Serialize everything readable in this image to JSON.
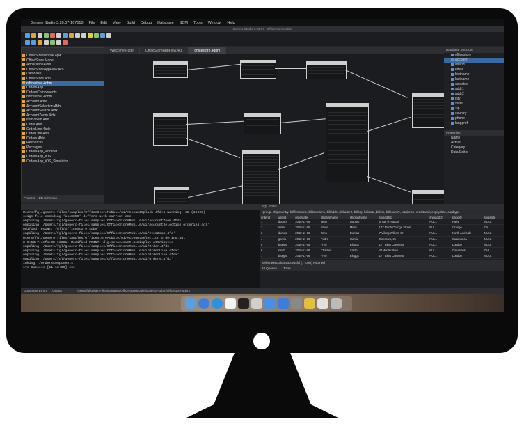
{
  "app": {
    "menubar": {
      "app_name": "Genero Studio 3.20.07-167010",
      "items": [
        "File",
        "Edit",
        "View",
        "Build",
        "Debug",
        "Database",
        "SCM",
        "Tools",
        "Window",
        "Help"
      ]
    },
    "window_title": "Genero Studio 3.20.07 - OfficeStoreMobile"
  },
  "project_tree": {
    "items": [
      {
        "label": "OfficeStoreMobile.4pw",
        "selected": false
      },
      {
        "label": "OfficeStore Model",
        "selected": false
      },
      {
        "label": "ApplicationFlow",
        "selected": false
      },
      {
        "label": "OfficeStoreAppFlow.4ca",
        "selected": false
      },
      {
        "label": "Database",
        "selected": false
      },
      {
        "label": "OfficeStore.4db",
        "selected": false
      },
      {
        "label": "officestore.4dbm",
        "selected": true
      },
      {
        "label": "OrdersApp",
        "selected": false
      },
      {
        "label": "OrdersComponents",
        "selected": false
      },
      {
        "label": "officestore.4dbm",
        "selected": false
      },
      {
        "label": "Account.4dbx",
        "selected": false
      },
      {
        "label": "AccountSelection.4fdx",
        "selected": false
      },
      {
        "label": "AccountSearch.4fdx",
        "selected": false
      },
      {
        "label": "AccountZoom.4fdx",
        "selected": false
      },
      {
        "label": "ItemZoom.4fdx",
        "selected": false
      },
      {
        "label": "Order.4fdx",
        "selected": false
      },
      {
        "label": "OrderLine.4bdx",
        "selected": false
      },
      {
        "label": "OrderLine.4fdx",
        "selected": false
      },
      {
        "label": "Orders.4fdx",
        "selected": false
      },
      {
        "label": "Resources",
        "selected": false
      },
      {
        "label": "Packages",
        "selected": false
      },
      {
        "label": "OrdersApp_Android",
        "selected": false
      },
      {
        "label": "OrdersApp_iOS",
        "selected": false
      },
      {
        "label": "OrdersApp_iOS_Simulator",
        "selected": false
      }
    ],
    "tabs": [
      "Projects",
      "DB Schemas"
    ]
  },
  "editor_tabs": [
    {
      "label": "Welcome Page",
      "active": false
    },
    {
      "label": "OfficeStoreAppFlow.4ca",
      "active": false
    },
    {
      "label": "officestore.4dbm",
      "active": true
    }
  ],
  "right_panel": {
    "title": "Database Structure",
    "items": [
      {
        "label": "officestore",
        "selected": false
      },
      {
        "label": "account",
        "selected": true
      },
      {
        "label": "userid",
        "selected": false
      },
      {
        "label": "email",
        "selected": false
      },
      {
        "label": "firstname",
        "selected": false
      },
      {
        "label": "lastname",
        "selected": false
      },
      {
        "label": "acstatus",
        "selected": false
      },
      {
        "label": "addr1",
        "selected": false
      },
      {
        "label": "addr2",
        "selected": false
      },
      {
        "label": "city",
        "selected": false
      },
      {
        "label": "state",
        "selected": false
      },
      {
        "label": "zip",
        "selected": false
      },
      {
        "label": "country",
        "selected": false
      },
      {
        "label": "phone",
        "selected": false
      },
      {
        "label": "langpref",
        "selected": false
      }
    ],
    "properties_title": "Properties",
    "properties": [
      "Name",
      "Active",
      "Category",
      "Data Editor"
    ]
  },
  "log": {
    "lines": [
      "Users/fgl/genero-files/samples/OfficeStoreMobile/ui/AccountSplash.4fd:1 warning: CD-(10195)",
      "ssign file encoding 'iso8859' differs with current one",
      "ompiling '/Users/fgl/genero-files/samples/OfficeStoreMobile/ui/AccountZoom.4fdx'",
      "ompiling '/Users/fgl/genero-files/samples/OfficeStoreMobile/ui/AccountSelection_ordering.4gl'",
      "odified 'POINT: full/OfficeStore.4dbm'",
      "ompiling '/Users/fgl/genero-files/samples/OfficeStoreMobile/ui/ItemZoom.4fd'",
      "Users/fgl/genero-files/samples/OfficeStoreMobile/ui/AccountSelection_ordering.4gl",
      "8:9:58:7(info:CD-13081: Modified POINT: dlg.setAccount.uiDisplay.attributes",
      "ompiling '/Users/fgl/genero-files/samples/OfficeStoreMobile/ui/Order.4fdx'",
      "ompiling '/Users/fgl/genero-files/samples/OfficeStoreMobile/ui/OrderLine.4fdx'",
      "ompiling '/Users/fgl/genero-files/samples/OfficeStoreMobile/ui/OrderLine.4fdx'",
      "ompiling '/Users/fgl/genero-files/samples/OfficeStoreMobile/ui/Orders.4fdx'",
      "inking '/OrdersComponents'",
      "ive Success [11:13:00].exe"
    ],
    "tabs": [
      "Document Errors",
      "Output"
    ]
  },
  "sql": {
    "title": "SQL Editor",
    "query": "*group, shipcountry, billfirstname, billlastname, billaddr1, billaddr2, billcity, billstate, billzip, billcountry, totalprice, creditcard, expirydate, cardtype",
    "columns": [
      "orderid",
      "userid",
      "orderdate",
      "shipfirstname",
      "shiplastname",
      "shipaddr1",
      "shipaddr2",
      "shipcity",
      "shipstate"
    ],
    "rows": [
      [
        "1",
        "dupont",
        "2018-11-06",
        "Jean",
        "Dupont",
        "5, rue d'Hopital",
        "NULL",
        "Paris",
        "NULL"
      ],
      [
        "2",
        "miller",
        "2018-11-06",
        "Steve",
        "Miller",
        "187 North Orange Street",
        "NULL",
        "Orange",
        "CA"
      ],
      [
        "3",
        "dumas",
        "2018-11-06",
        "John",
        "Dumas",
        "7 Viking William St",
        "NULL",
        "North Adelaide",
        "NULL"
      ],
      [
        "4",
        "garcia",
        "2018-11-06",
        "Pedro",
        "Garcia",
        "Consoles, 21",
        "NULL",
        "Salamanca",
        "NULL"
      ],
      [
        "5",
        "bloggs",
        "2018-11-06",
        "Fred",
        "Bloggs",
        "177 Elms Crescent",
        "NULL",
        "London",
        "NULL"
      ],
      [
        "6",
        "smith",
        "2018-11-06",
        "Charles",
        "Smith",
        "44 Winter Way",
        "NULL",
        "Columbus",
        "OH"
      ],
      [
        "7",
        "bloggs",
        "2018-11-06",
        "Fred",
        "Bloggs",
        "177 Elms Crescent",
        "NULL",
        "London",
        "NULL"
      ]
    ],
    "status": "Select execution successful (7 rows) returned",
    "tabs": [
      "All Queries",
      "Tools"
    ]
  },
  "status_bar": {
    "path": "/Users/fgl/genero-files/samples/OfficeStoreMobile/schema-4dbm/officestore.4dbm"
  },
  "colors": {
    "selection": "#3b6aa3",
    "editor_bg": "#1b1c1f",
    "panel_bg": "#1e2023",
    "entity_border": "#cfcfcf"
  }
}
